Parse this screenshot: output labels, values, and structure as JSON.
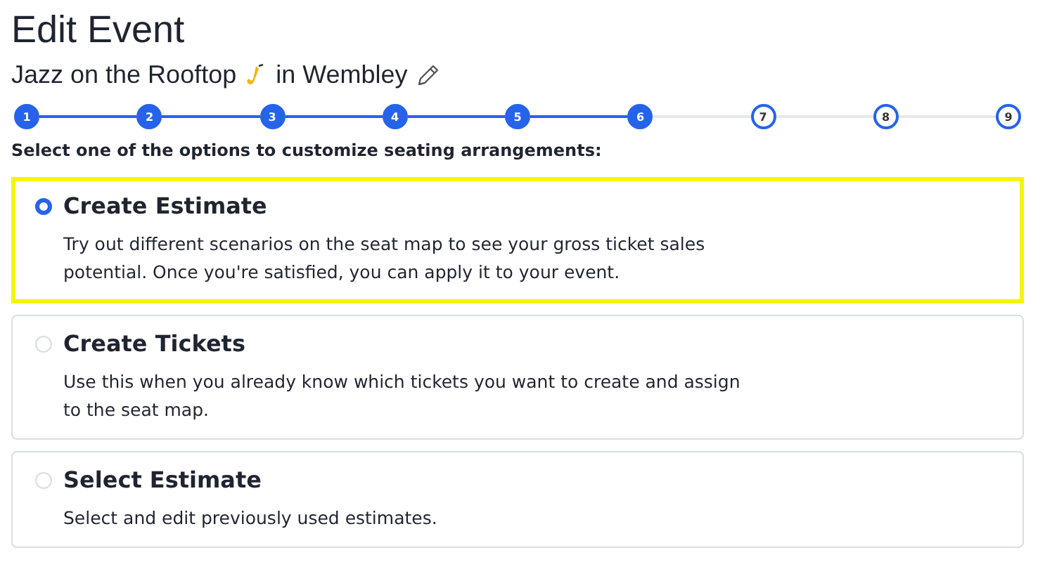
{
  "heading": "Edit Event",
  "event": {
    "name": "Jazz on the Rooftop",
    "venue": "in Wembley"
  },
  "steps": [
    {
      "label": "1",
      "done": true
    },
    {
      "label": "2",
      "done": true
    },
    {
      "label": "3",
      "done": true
    },
    {
      "label": "4",
      "done": true
    },
    {
      "label": "5",
      "done": true
    },
    {
      "label": "6",
      "done": true
    },
    {
      "label": "7",
      "done": false
    },
    {
      "label": "8",
      "done": false
    },
    {
      "label": "9",
      "done": false
    }
  ],
  "prompt": "Select one of the options to customize seating arrangements:",
  "options": [
    {
      "title": "Create Estimate",
      "description": "Try out different scenarios on the seat map to see your gross ticket sales potential. Once you're satisfied, you can apply it to your event.",
      "selected": true
    },
    {
      "title": "Create Tickets",
      "description": "Use this when you already know which tickets you want to create and assign to the seat map.",
      "selected": false
    },
    {
      "title": "Select Estimate",
      "description": "Select and edit previously used estimates.",
      "selected": false
    }
  ]
}
